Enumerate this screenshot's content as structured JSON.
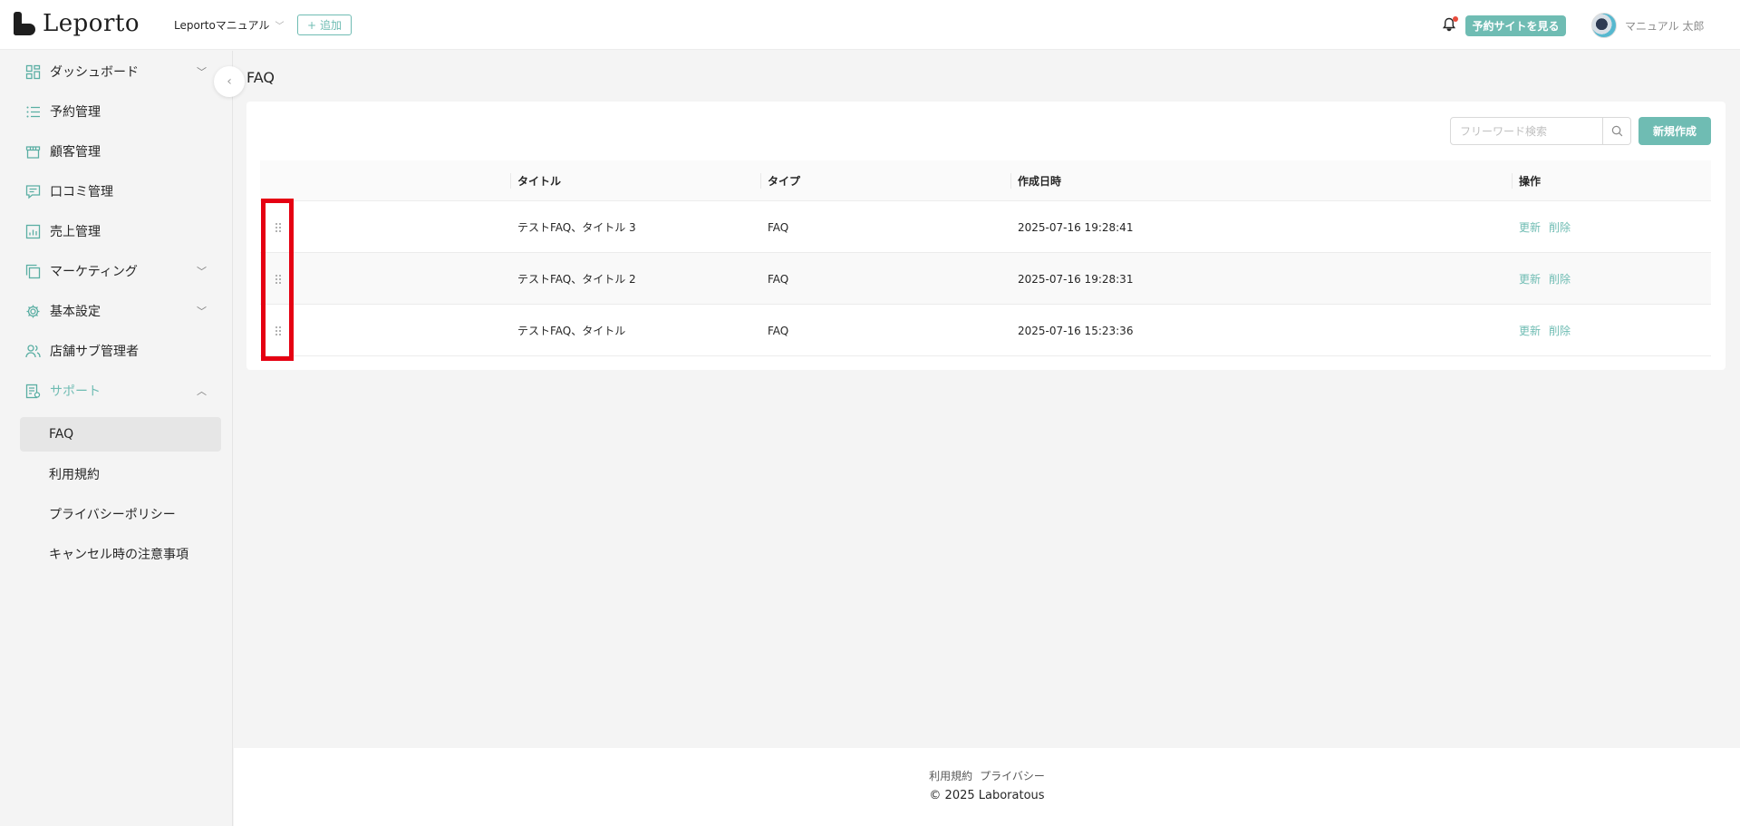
{
  "header": {
    "logo_text": "Leporto",
    "shop_name": "Leportoマニュアル",
    "add_label": "追加",
    "reserve_site_label": "予約サイトを見る",
    "user_name": "マニュアル 太郎",
    "notification_dot": true
  },
  "sidebar": {
    "items": [
      {
        "label": "ダッシュボード",
        "icon": "dashboard-icon",
        "has_arrow": true
      },
      {
        "label": "予約管理",
        "icon": "list-icon",
        "has_arrow": false
      },
      {
        "label": "顧客管理",
        "icon": "store-icon",
        "has_arrow": false
      },
      {
        "label": "口コミ管理",
        "icon": "review-icon",
        "has_arrow": false
      },
      {
        "label": "売上管理",
        "icon": "sales-chart-icon",
        "has_arrow": false
      },
      {
        "label": "マーケティング",
        "icon": "copy-icon",
        "has_arrow": true
      },
      {
        "label": "基本設定",
        "icon": "gear-icon",
        "has_arrow": true
      },
      {
        "label": "店舗サブ管理者",
        "icon": "users-icon",
        "has_arrow": false
      },
      {
        "label": "サポート",
        "icon": "support-doc-icon",
        "has_arrow": true,
        "expanded": true
      }
    ],
    "sub_items": [
      {
        "label": "FAQ",
        "active": true
      },
      {
        "label": "利用規約",
        "active": false
      },
      {
        "label": "プライバシーポリシー",
        "active": false
      },
      {
        "label": "キャンセル時の注意事項",
        "active": false
      }
    ]
  },
  "main": {
    "page_title": "FAQ",
    "search_placeholder": "フリーワード検索",
    "new_button_label": "新規作成",
    "table": {
      "headers": [
        "",
        "タイトル",
        "タイプ",
        "作成日時",
        "操作"
      ],
      "rows": [
        {
          "title": "テストFAQ、タイトル 3",
          "type": "FAQ",
          "created_at": "2025-07-16 19:28:41",
          "update": "更新",
          "delete": "削除"
        },
        {
          "title": "テストFAQ、タイトル 2",
          "type": "FAQ",
          "created_at": "2025-07-16 19:28:31",
          "update": "更新",
          "delete": "削除"
        },
        {
          "title": "テストFAQ、タイトル",
          "type": "FAQ",
          "created_at": "2025-07-16 15:23:36",
          "update": "更新",
          "delete": "削除"
        }
      ]
    }
  },
  "footer": {
    "links": [
      "利用規約",
      "プライバシー"
    ],
    "copyright": "© 2025 Laboratous"
  },
  "colors": {
    "accent": "#6fbcb3",
    "highlight": "#e50012",
    "background": "#f4f4f4"
  }
}
